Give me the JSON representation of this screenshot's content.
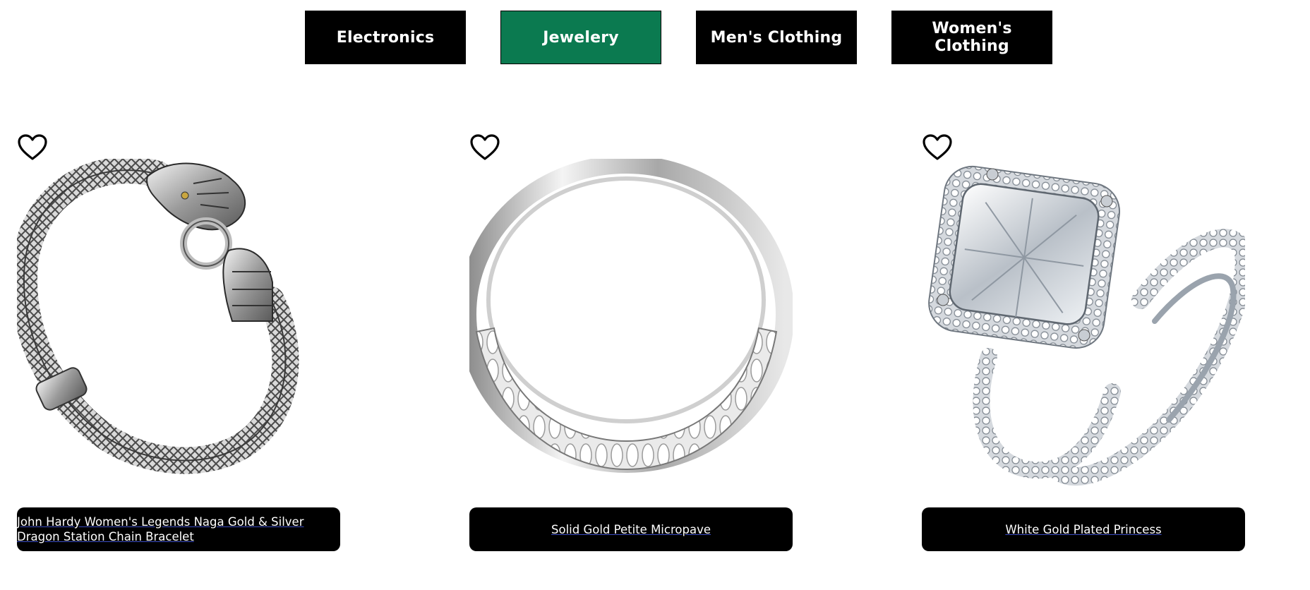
{
  "categories": [
    {
      "label": "Electronics",
      "active": false
    },
    {
      "label": "Jewelery",
      "active": true
    },
    {
      "label": "Men's Clothing",
      "active": false
    },
    {
      "label": "Women's Clothing",
      "active": false
    }
  ],
  "colors": {
    "tab_bg": "#000000",
    "tab_active_bg": "#0b7a50",
    "tab_text": "#ffffff",
    "card_title_bg": "#000000"
  },
  "products": [
    {
      "title": "John Hardy Women's Legends Naga Gold & Silver Dragon Station Chain Bracelet",
      "image_icon": "dragon-chain-bracelet-image",
      "favorite_icon": "heart-outline-icon"
    },
    {
      "title": "Solid Gold Petite Micropave",
      "image_icon": "micropave-ring-image",
      "favorite_icon": "heart-outline-icon"
    },
    {
      "title": "White Gold Plated Princess",
      "image_icon": "princess-ring-set-image",
      "favorite_icon": "heart-outline-icon"
    }
  ]
}
